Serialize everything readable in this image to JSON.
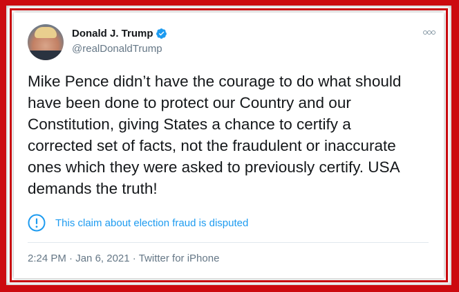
{
  "tweet": {
    "author_name": "Donald J. Trump",
    "author_handle": "@realDonaldTrump",
    "text": "Mike Pence didn’t have the courage to do what should\nhave been done to protect our Country and our\nConstitution, giving States a chance to certify a\ncorrected set of facts, not the fraudulent or inaccurate\nones which they were asked to previously certify. USA\ndemands the truth!",
    "notice": "This claim about election fraud is disputed",
    "time": "2:24 PM",
    "separator": "·",
    "date": "Jan 6, 2021",
    "source": "Twitter for iPhone"
  },
  "icons": {
    "verified": "verified-badge-icon",
    "more": "more-options-icon",
    "notice": "exclamation-circle-icon"
  },
  "colors": {
    "frame": "#cc0a0f",
    "accent": "#1d9bf0",
    "text": "#14171a",
    "secondary": "#657786"
  }
}
